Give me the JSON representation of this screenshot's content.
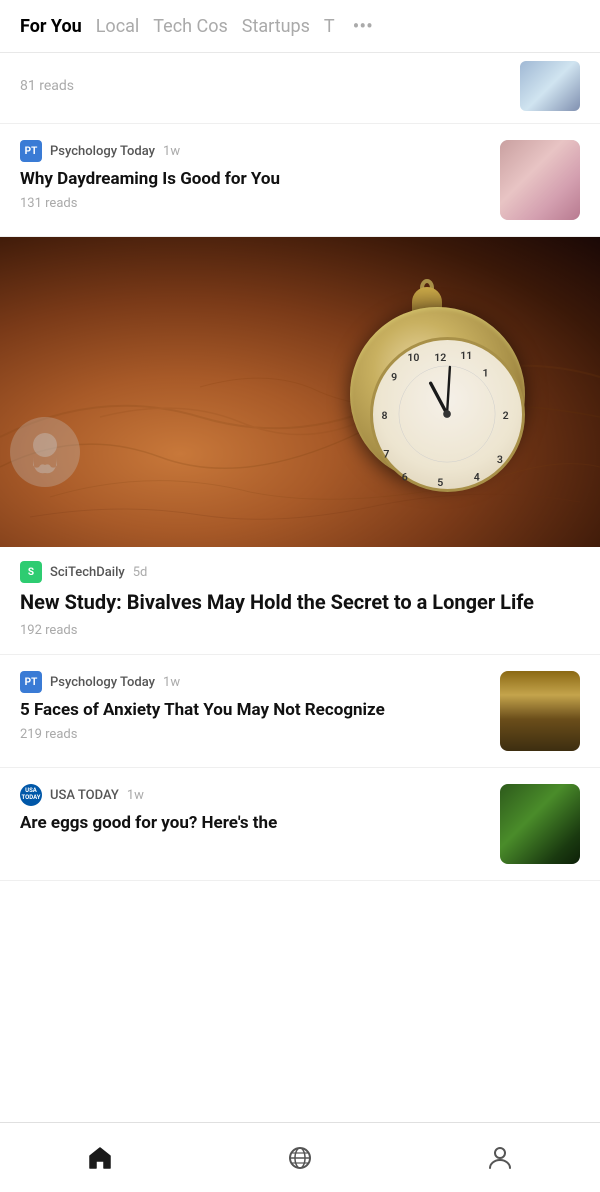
{
  "nav": {
    "items": [
      {
        "label": "For You",
        "active": true
      },
      {
        "label": "Local",
        "active": false
      },
      {
        "label": "Tech Cos",
        "active": false
      },
      {
        "label": "Startups",
        "active": false
      },
      {
        "label": "T",
        "active": false
      }
    ],
    "more_icon": "•••"
  },
  "articles": [
    {
      "id": "partial-top",
      "reads": "81 reads",
      "has_thumb": true
    },
    {
      "id": "psychology-daydream",
      "source": "Psychology Today",
      "source_abbr": "PT",
      "source_type": "pt",
      "time": "1w",
      "title": "Why Daydreaming Is Good for You",
      "reads": "131 reads",
      "has_thumb": true
    },
    {
      "id": "scitech-bivalves",
      "source": "SciTechDaily",
      "source_abbr": "S",
      "source_type": "st",
      "time": "5d",
      "title": "New Study: Bivalves May Hold the Secret to a Longer Life",
      "reads": "192 reads",
      "featured": true
    },
    {
      "id": "psychology-anxiety",
      "source": "Psychology Today",
      "source_abbr": "PT",
      "source_type": "pt",
      "time": "1w",
      "title": "5 Faces of Anxiety That You May Not Recognize",
      "reads": "219 reads",
      "has_thumb": true
    },
    {
      "id": "usa-today-eggs",
      "source": "USA TODAY",
      "source_abbr": "USA",
      "source_type": "usa",
      "time": "1w",
      "title": "Are eggs good for you? Here's the",
      "reads": "",
      "has_thumb": true,
      "partial": true
    }
  ],
  "bottom_nav": {
    "items": [
      {
        "label": "home",
        "icon": "home-icon",
        "active": true
      },
      {
        "label": "browse",
        "icon": "globe-icon",
        "active": false
      },
      {
        "label": "profile",
        "icon": "person-icon",
        "active": false
      }
    ]
  }
}
